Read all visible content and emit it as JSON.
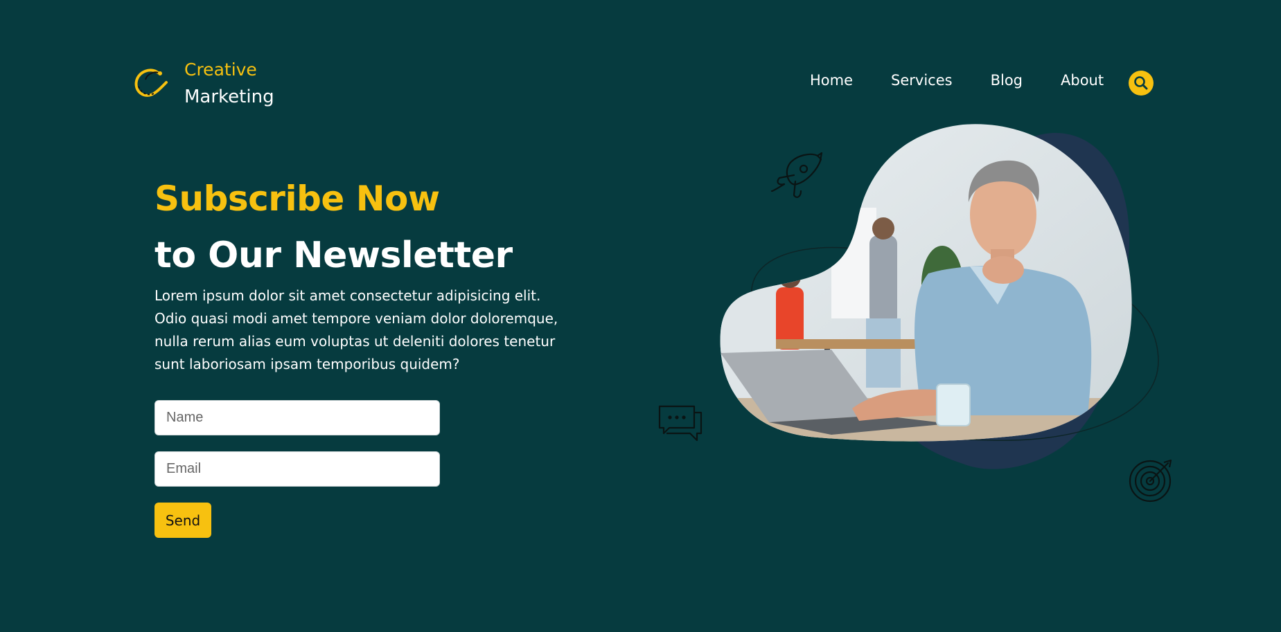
{
  "brand": {
    "line1": "Creative",
    "line2": "Marketing",
    "icon": "c-logo-icon"
  },
  "nav": {
    "items": [
      {
        "label": "Home"
      },
      {
        "label": "Services"
      },
      {
        "label": "Blog"
      },
      {
        "label": "About"
      }
    ],
    "search_icon": "search-icon"
  },
  "hero": {
    "title_line1": "Subscribe Now",
    "title_line2": "to Our Newsletter",
    "description": "Lorem ipsum dolor sit amet consectetur adipisicing elit. Odio quasi modi amet tempore veniam dolor doloremque, nulla rerum alias eum voluptas ut deleniti dolores tenetur sunt laboriosam ipsam temporibus quidem?"
  },
  "form": {
    "name_placeholder": "Name",
    "email_placeholder": "Email",
    "send_label": "Send"
  },
  "illustration": {
    "icons": [
      "rocket-icon",
      "chat-bubbles-icon",
      "target-icon"
    ],
    "photo": "man-at-laptop-photo"
  },
  "colors": {
    "background": "#063b3f",
    "accent": "#f7c110",
    "blob_shadow": "#1f3550"
  }
}
